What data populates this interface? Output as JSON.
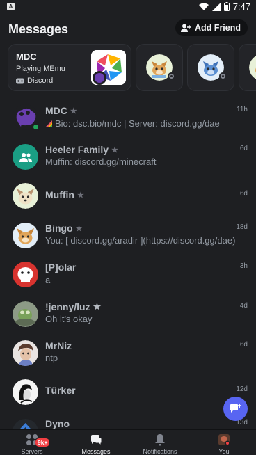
{
  "status_bar": {
    "time": "7:47",
    "app_icon_letter": "A"
  },
  "header": {
    "title": "Messages",
    "add_friend_label": "Add Friend"
  },
  "activity_card": {
    "name": "MDC",
    "activity": "Playing MEmu",
    "app": "Discord"
  },
  "conversations": [
    {
      "name": "MDC",
      "message": "Bio: dsc.bio/mdc | Server: discord.gg/dae",
      "time": "11h",
      "online": true
    },
    {
      "name": "Heeler Family",
      "message": "Muffin: discord.gg/minecraft",
      "time": "6d"
    },
    {
      "name": "Muffin",
      "message": "",
      "time": "6d"
    },
    {
      "name": "Bingo",
      "message": "You: [ discord.gg/aradir ](https://discord.gg/dae)",
      "time": "18d"
    },
    {
      "name": "[P]olar",
      "message": "a",
      "time": "3h"
    },
    {
      "name": "!jenny/luz",
      "message": "Oh it's okay",
      "time": "4d"
    },
    {
      "name": "MrNiz",
      "message": "ntp",
      "time": "6d"
    },
    {
      "name": "Türker",
      "message": "",
      "time": "12d"
    },
    {
      "name": "Dyno",
      "message": "",
      "time": "13d"
    }
  ],
  "bottom_nav": {
    "servers": "Servers",
    "servers_badge": "9k+",
    "messages": "Messages",
    "notifications": "Notifications",
    "you": "You"
  },
  "colors": {
    "accent": "#5865f2",
    "background": "#1e1f22",
    "online": "#23a55a",
    "badge": "#f23f43"
  }
}
